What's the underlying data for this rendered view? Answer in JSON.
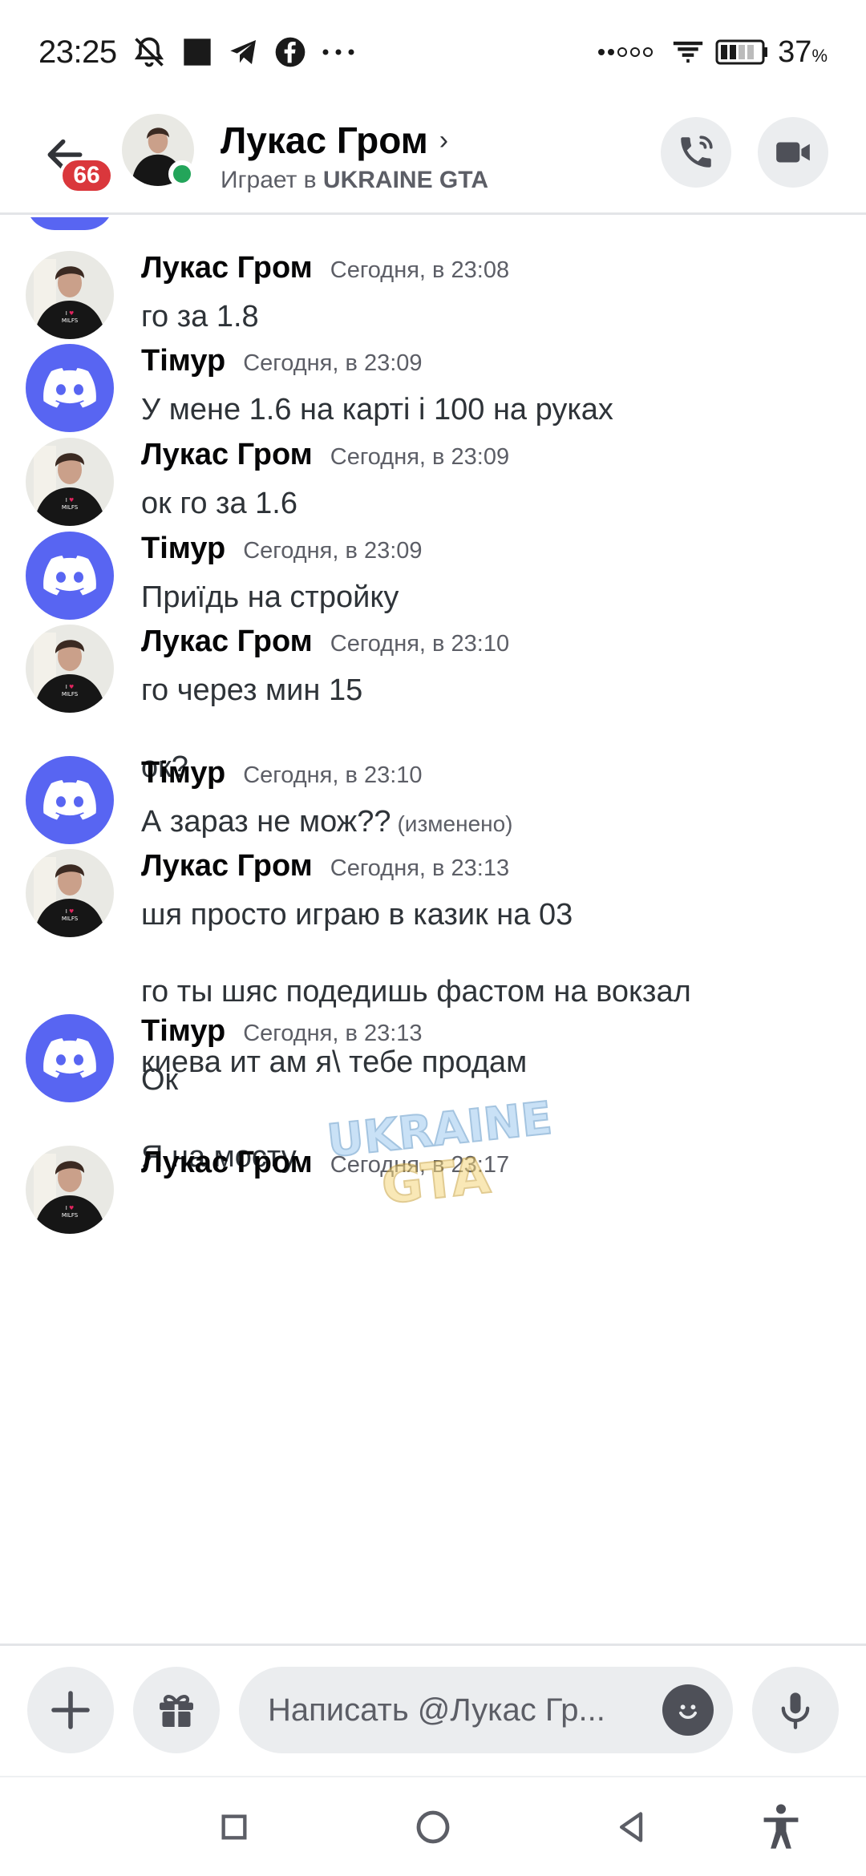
{
  "status_bar": {
    "time": "23:25",
    "battery": "37",
    "battery_unit": "%"
  },
  "header": {
    "unread_badge": "66",
    "name": "Лукас Гром",
    "chevron": "›",
    "activity_prefix": "Играет в",
    "activity_game": "UKRAINE GTA"
  },
  "messages": [
    {
      "author": "Лукас Гром",
      "time": "Сегодня, в 23:08",
      "avatar": "photo",
      "lines": [
        "го за 1.8"
      ]
    },
    {
      "author": "Тімур",
      "time": "Сегодня, в 23:09",
      "avatar": "discord",
      "lines": [
        "У мене 1.6 на карті і 100 на руках"
      ]
    },
    {
      "author": "Лукас Гром",
      "time": "Сегодня, в 23:09",
      "avatar": "photo",
      "lines": [
        "ок го за 1.6"
      ]
    },
    {
      "author": "Тімур",
      "time": "Сегодня, в 23:09",
      "avatar": "discord",
      "lines": [
        "Приїдь на стройку"
      ]
    },
    {
      "author": "Лукас Гром",
      "time": "Сегодня, в 23:10",
      "avatar": "photo",
      "lines": [
        "го через мин 15",
        "ок?"
      ]
    },
    {
      "author": "Тімур",
      "time": "Сегодня, в 23:10",
      "avatar": "discord",
      "lines": [
        "А зараз не мож??"
      ],
      "edited": "(изменено)"
    },
    {
      "author": "Лукас Гром",
      "time": "Сегодня, в 23:13",
      "avatar": "photo",
      "lines": [
        "шя просто играю в казик на 03",
        "го ты шяс подедишь фастом на вокзал",
        "киева ит ам я\\ тебе продам"
      ]
    },
    {
      "author": "Тімур",
      "time": "Сегодня, в 23:13",
      "avatar": "discord",
      "lines": [
        "Ок",
        "Я на мосту"
      ]
    },
    {
      "author": "Лукас Гром",
      "time": "Сегодня, в 23:17",
      "avatar": "photo",
      "lines": []
    }
  ],
  "avatar_shirt_text": [
    "I",
    "♥",
    "MILFS"
  ],
  "watermark_text": [
    "UKRAINE",
    "GTA"
  ],
  "composer": {
    "placeholder": "Написать @Лукас Гр..."
  },
  "icons": {
    "back": "arrow-left-icon",
    "call": "phone-icon",
    "video": "video-camera-icon",
    "add": "plus-icon",
    "gift": "gift-icon",
    "emoji": "emoji-icon",
    "mic": "microphone-icon",
    "scroll_down": "arrow-down-icon",
    "nav_recent": "square-icon",
    "nav_home": "circle-icon",
    "nav_back": "triangle-back-icon",
    "nav_accessibility": "accessibility-icon"
  },
  "colors": {
    "discord_blurple": "#5865f2",
    "online": "#23a55a",
    "badge_red": "#da373c"
  }
}
